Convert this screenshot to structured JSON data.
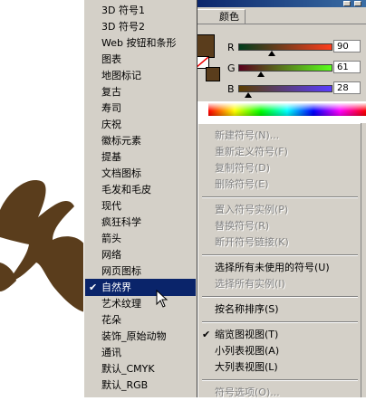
{
  "colors": {
    "artwork": "#5a3d1c",
    "selection": "#0a246a",
    "menu_bg": "#d4d0c8",
    "disabled_text": "#808080"
  },
  "color_panel": {
    "tab_label": "颜色",
    "channels": [
      {
        "label": "R",
        "value": "90",
        "level": 0.353
      },
      {
        "label": "G",
        "value": "61",
        "level": 0.239
      },
      {
        "label": "B",
        "value": "28",
        "level": 0.11
      }
    ]
  },
  "library_list": {
    "items": [
      {
        "label": "3D 符号1"
      },
      {
        "label": "3D 符号2"
      },
      {
        "label": "Web 按钮和条形"
      },
      {
        "label": "图表"
      },
      {
        "label": "地图标记"
      },
      {
        "label": "复古"
      },
      {
        "label": "寿司"
      },
      {
        "label": "庆祝"
      },
      {
        "label": "徽标元素"
      },
      {
        "label": "提基"
      },
      {
        "label": "文档图标"
      },
      {
        "label": "毛发和毛皮"
      },
      {
        "label": "现代"
      },
      {
        "label": "疯狂科学"
      },
      {
        "label": "箭头"
      },
      {
        "label": "网络"
      },
      {
        "label": "网页图标"
      },
      {
        "label": "自然界",
        "checked": true,
        "selected": true
      },
      {
        "label": "艺术纹理"
      },
      {
        "label": "花朵"
      },
      {
        "label": "装饰_原始动物"
      },
      {
        "label": "通讯"
      },
      {
        "label": "默认_CMYK"
      },
      {
        "label": "默认_RGB"
      }
    ],
    "check_glyph": "✔"
  },
  "panel_menu": {
    "items": [
      {
        "label": "新建符号(N)...",
        "disabled": true
      },
      {
        "label": "重新定义符号(F)",
        "disabled": true
      },
      {
        "label": "复制符号(D)",
        "disabled": true
      },
      {
        "label": "删除符号(E)",
        "disabled": true
      },
      {
        "sep": true
      },
      {
        "label": "置入符号实例(P)",
        "disabled": true
      },
      {
        "label": "替换符号(R)",
        "disabled": true
      },
      {
        "label": "断开符号链接(K)",
        "disabled": true
      },
      {
        "sep": true
      },
      {
        "label": "选择所有未使用的符号(U)",
        "disabled": false
      },
      {
        "label": "选择所有实例(I)",
        "disabled": true
      },
      {
        "sep": true
      },
      {
        "label": "按名称排序(S)",
        "disabled": false
      },
      {
        "sep": true
      },
      {
        "label": "缩览图视图(T)",
        "disabled": false,
        "checked": true
      },
      {
        "label": "小列表视图(A)",
        "disabled": false
      },
      {
        "label": "大列表视图(L)",
        "disabled": false
      },
      {
        "sep": true
      },
      {
        "label": "符号选项(O)...",
        "disabled": true
      }
    ]
  }
}
